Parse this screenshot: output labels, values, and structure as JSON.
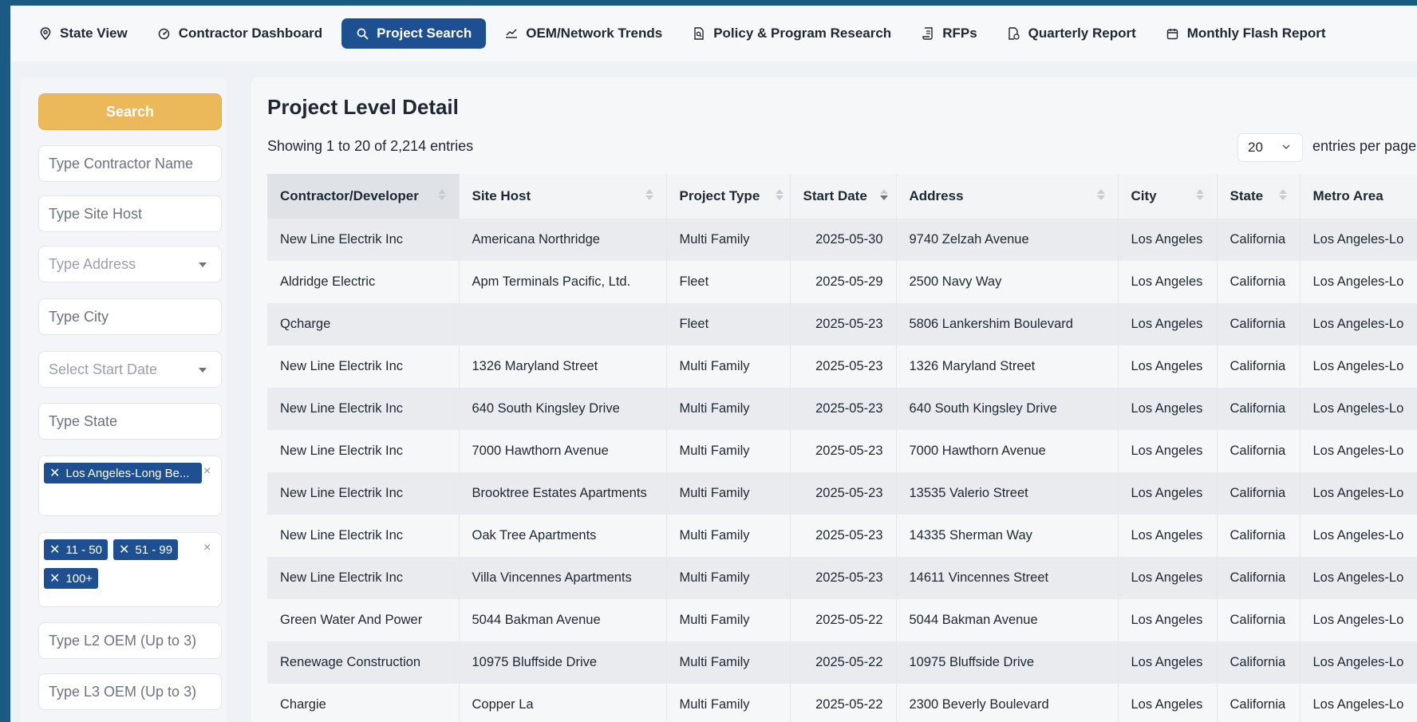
{
  "nav": {
    "items": [
      {
        "label": "State View",
        "icon": "location-pin-icon"
      },
      {
        "label": "Contractor Dashboard",
        "icon": "gauge-icon"
      },
      {
        "label": "Project Search",
        "icon": "search-icon",
        "active": true
      },
      {
        "label": "OEM/Network Trends",
        "icon": "trend-chart-icon"
      },
      {
        "label": "Policy & Program Research",
        "icon": "document-search-icon"
      },
      {
        "label": "RFPs",
        "icon": "scroll-icon"
      },
      {
        "label": "Quarterly Report",
        "icon": "report-icon"
      },
      {
        "label": "Monthly Flash Report",
        "icon": "calendar-icon"
      }
    ]
  },
  "sidebar": {
    "search_label": "Search",
    "contractor_placeholder": "Type Contractor Name",
    "site_host_placeholder": "Type Site Host",
    "address_placeholder": "Type Address",
    "city_placeholder": "Type City",
    "start_date_placeholder": "Select Start Date",
    "state_placeholder": "Type State",
    "metro_tags": [
      "Los Angeles-Long Be..."
    ],
    "size_tags": [
      "11 - 50",
      "51 - 99",
      "100+"
    ],
    "l2_oem_placeholder": "Type L2 OEM (Up to 3)",
    "l3_oem_placeholder": "Type L3 OEM (Up to 3)",
    "tag_remove_glyph": "✕",
    "clear_glyph": "×"
  },
  "main": {
    "title": "Project Level Detail",
    "info": "Showing 1 to 20 of 2,214 entries",
    "per_page_value": "20",
    "per_page_label": "entries per page",
    "columns": [
      "Contractor/Developer",
      "Site Host",
      "Project Type",
      "Start Date",
      "Address",
      "City",
      "State",
      "Metro Area"
    ],
    "rows": [
      [
        "New Line Electrik Inc",
        "Americana Northridge",
        "Multi Family",
        "2025-05-30",
        "9740 Zelzah Avenue",
        "Los Angeles",
        "California",
        "Los Angeles-Lo"
      ],
      [
        "Aldridge Electric",
        "Apm Terminals Pacific, Ltd.",
        "Fleet",
        "2025-05-29",
        "2500 Navy Way",
        "Los Angeles",
        "California",
        "Los Angeles-Lo"
      ],
      [
        "Qcharge",
        "",
        "Fleet",
        "2025-05-23",
        "5806 Lankershim Boulevard",
        "Los Angeles",
        "California",
        "Los Angeles-Lo"
      ],
      [
        "New Line Electrik Inc",
        "1326 Maryland Street",
        "Multi Family",
        "2025-05-23",
        "1326 Maryland Street",
        "Los Angeles",
        "California",
        "Los Angeles-Lo"
      ],
      [
        "New Line Electrik Inc",
        "640 South Kingsley Drive",
        "Multi Family",
        "2025-05-23",
        "640 South Kingsley Drive",
        "Los Angeles",
        "California",
        "Los Angeles-Lo"
      ],
      [
        "New Line Electrik Inc",
        "7000 Hawthorn Avenue",
        "Multi Family",
        "2025-05-23",
        "7000 Hawthorn Avenue",
        "Los Angeles",
        "California",
        "Los Angeles-Lo"
      ],
      [
        "New Line Electrik Inc",
        "Brooktree Estates Apartments",
        "Multi Family",
        "2025-05-23",
        "13535 Valerio Street",
        "Los Angeles",
        "California",
        "Los Angeles-Lo"
      ],
      [
        "New Line Electrik Inc",
        "Oak Tree Apartments",
        "Multi Family",
        "2025-05-23",
        "14335 Sherman Way",
        "Los Angeles",
        "California",
        "Los Angeles-Lo"
      ],
      [
        "New Line Electrik Inc",
        "Villa Vincennes Apartments",
        "Multi Family",
        "2025-05-23",
        "14611 Vincennes Street",
        "Los Angeles",
        "California",
        "Los Angeles-Lo"
      ],
      [
        "Green Water And Power",
        "5044 Bakman Avenue",
        "Multi Family",
        "2025-05-22",
        "5044 Bakman Avenue",
        "Los Angeles",
        "California",
        "Los Angeles-Lo"
      ],
      [
        "Renewage Construction",
        "10975 Bluffside Drive",
        "Multi Family",
        "2025-05-22",
        "10975 Bluffside Drive",
        "Los Angeles",
        "California",
        "Los Angeles-Lo"
      ],
      [
        "Chargie",
        "Copper La",
        "Multi Family",
        "2025-05-22",
        "2300 Beverly Boulevard",
        "Los Angeles",
        "California",
        "Los Angeles-Lo"
      ]
    ]
  },
  "colors": {
    "accent": "#1d4f91",
    "search_button": "#ebb85a",
    "frame_border": "#1a5a85"
  }
}
